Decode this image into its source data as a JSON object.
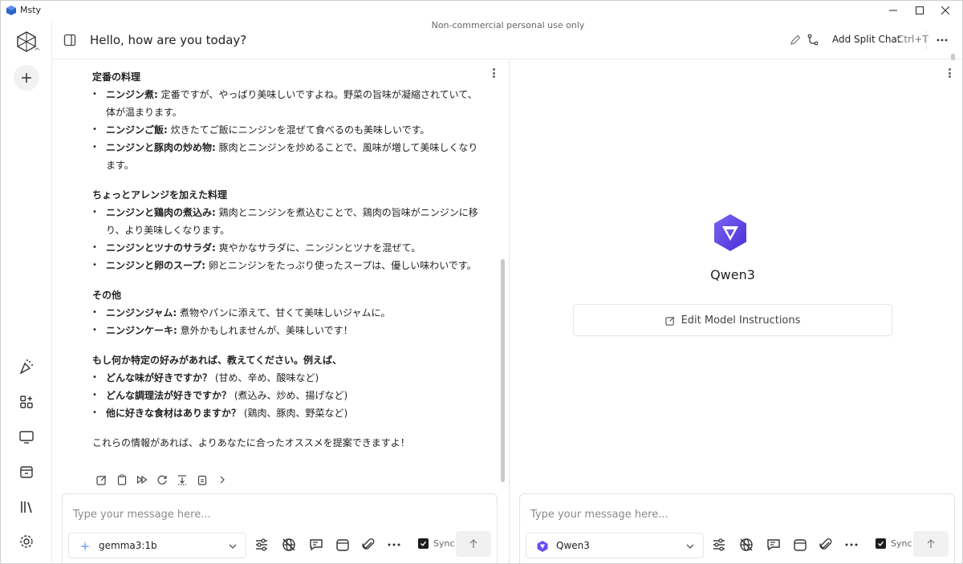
{
  "window": {
    "title": "Msty",
    "notice": "Non-commercial personal use only"
  },
  "header": {
    "chat_title": "Hello, how are you today?",
    "split_label": "Add Split Chat",
    "split_shortcut": "Ctrl+T"
  },
  "message": {
    "sections": [
      {
        "title": "定番の料理",
        "items": [
          {
            "bold": "ニンジン煮:",
            "text": " 定番ですが、やっぱり美味しいですよね。野菜の旨味が凝縮されていて、体が温まります。"
          },
          {
            "bold": "ニンジンご飯:",
            "text": " 炊きたてご飯にニンジンを混ぜて食べるのも美味しいです。"
          },
          {
            "bold": "ニンジンと豚肉の炒め物:",
            "text": " 豚肉とニンジンを炒めることで、風味が増して美味しくなります。"
          }
        ]
      },
      {
        "title": "ちょっとアレンジを加えた料理",
        "items": [
          {
            "bold": "ニンジンと鶏肉の煮込み:",
            "text": " 鶏肉とニンジンを煮込むことで、鶏肉の旨味がニンジンに移り、より美味しくなります。"
          },
          {
            "bold": "ニンジンとツナのサラダ:",
            "text": " 爽やかなサラダに、ニンジンとツナを混ぜて。"
          },
          {
            "bold": "ニンジンと卵のスープ:",
            "text": " 卵とニンジンをたっぷり使ったスープは、優しい味わいです。"
          }
        ]
      },
      {
        "title": "その他",
        "items": [
          {
            "bold": "ニンジンジャム:",
            "text": " 煮物やパンに添えて、甘くて美味しいジャムに。"
          },
          {
            "bold": "ニンジンケーキ:",
            "text": " 意外かもしれませんが、美味しいです！"
          }
        ]
      },
      {
        "title": "もし何か特定の好みがあれば、教えてください。例えば、",
        "items": [
          {
            "bold": "どんな味が好きですか？",
            "text": " (甘め、辛め、酸味など)"
          },
          {
            "bold": "どんな調理法が好きですか？",
            "text": " (煮込み、炒め、揚げなど)"
          },
          {
            "bold": "他に好きな食材はありますか？",
            "text": " (鶏肉、豚肉、野菜など)"
          }
        ]
      }
    ],
    "closing": "これらの情報があれば、よりあなたに合ったオススメを提案できますよ！"
  },
  "left_composer": {
    "placeholder": "Type your message here...",
    "model": "gemma3:1b",
    "sync_label": "Sync"
  },
  "right_composer": {
    "placeholder": "Type your message here...",
    "model": "Qwen3",
    "sync_label": "Sync"
  },
  "right_pane": {
    "model_name": "Qwen3",
    "edit_instructions_label": "Edit Model Instructions"
  },
  "colors": {
    "accent_purple": "#6a4cf0",
    "text": "#222222",
    "muted": "#8a8a8a"
  }
}
